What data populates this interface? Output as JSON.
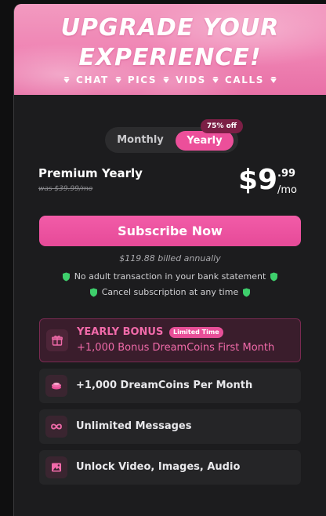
{
  "hero": {
    "title_line1": "UPGRADE YOUR",
    "title_line2": "EXPERIENCE!",
    "tags": [
      "CHAT",
      "PICS",
      "VIDS",
      "CALLS"
    ]
  },
  "billing_toggle": {
    "monthly_label": "Monthly",
    "yearly_label": "Yearly",
    "selected": "Yearly",
    "discount_badge": "75% off"
  },
  "plan": {
    "name": "Premium Yearly",
    "was_price": "was $39.99/mo",
    "price_main": "$9",
    "price_cents": ".99",
    "price_period": "/mo"
  },
  "cta": {
    "subscribe_label": "Subscribe Now",
    "billed_text": "$119.88 billed annually"
  },
  "assurances": [
    "No adult transaction in your bank statement",
    "Cancel subscription at any time"
  ],
  "bonus": {
    "title": "YEARLY BONUS",
    "badge": "Limited Time",
    "description": "+1,000 Bonus DreamCoins First Month",
    "icon": "gift-icon"
  },
  "features": [
    {
      "label": "+1,000 DreamCoins Per Month",
      "icon": "coins-icon"
    },
    {
      "label": "Unlimited Messages",
      "icon": "infinity-icon"
    },
    {
      "label": "Unlock Video, Images, Audio",
      "icon": "image-icon"
    }
  ],
  "colors": {
    "accent": "#ec4f9a",
    "shield_green": "#3ecf6c",
    "background": "#1c1c1e"
  }
}
